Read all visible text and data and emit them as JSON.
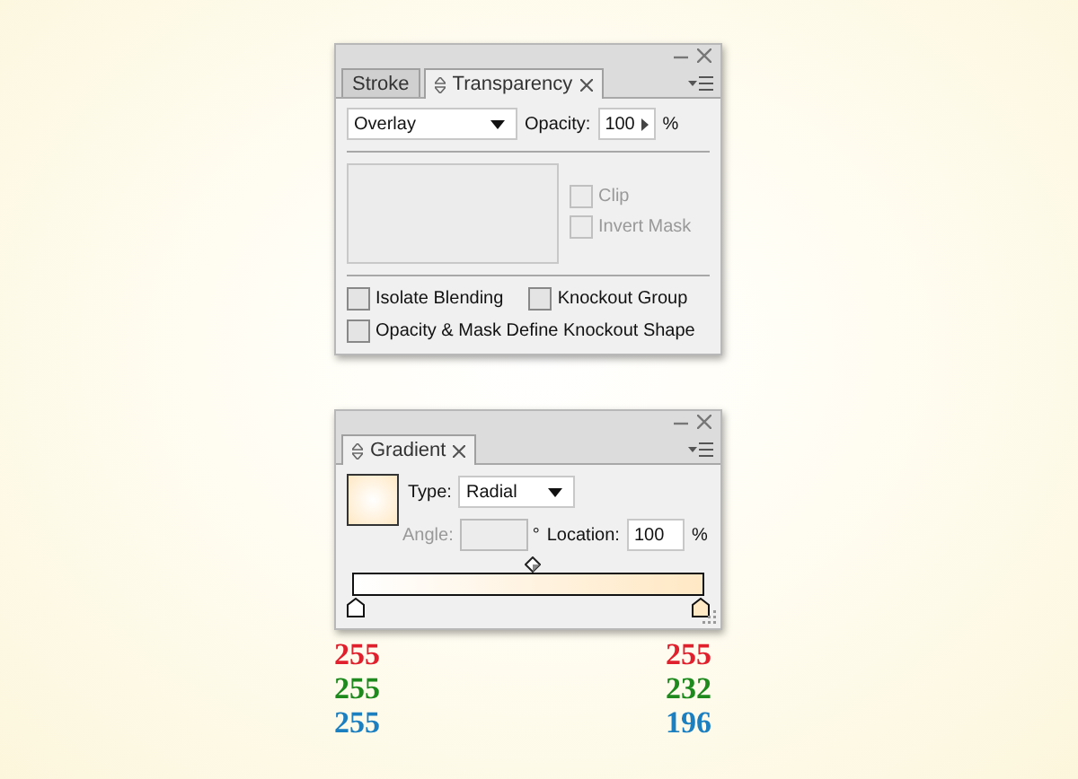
{
  "transparency_panel": {
    "tabs": [
      {
        "label": "Stroke",
        "selected": false
      },
      {
        "label": "Transparency",
        "selected": true
      }
    ],
    "blend_mode": "Overlay",
    "opacity_label": "Opacity:",
    "opacity": "100",
    "opacity_unit": "%",
    "mask_options": [
      {
        "label": "Clip",
        "checked": false,
        "disabled": true
      },
      {
        "label": "Invert Mask",
        "checked": false,
        "disabled": true
      }
    ],
    "options": [
      {
        "label": "Isolate Blending",
        "checked": false
      },
      {
        "label": "Knockout Group",
        "checked": false
      },
      {
        "label": "Opacity & Mask Define Knockout Shape",
        "checked": false
      }
    ]
  },
  "gradient_panel": {
    "tabs": [
      {
        "label": "Gradient",
        "selected": true
      }
    ],
    "type_label": "Type:",
    "type": "Radial",
    "angle_label": "Angle:",
    "angle_disabled": true,
    "angle_unit": "°",
    "location_label": "Location:",
    "location": "100",
    "location_unit": "%",
    "stops": [
      {
        "color": "#ffffff"
      },
      {
        "color": "#ffe8c4"
      }
    ]
  },
  "stop_values": [
    {
      "red": "255",
      "green": "255",
      "blue": "255"
    },
    {
      "red": "255",
      "green": "232",
      "blue": "196"
    }
  ]
}
